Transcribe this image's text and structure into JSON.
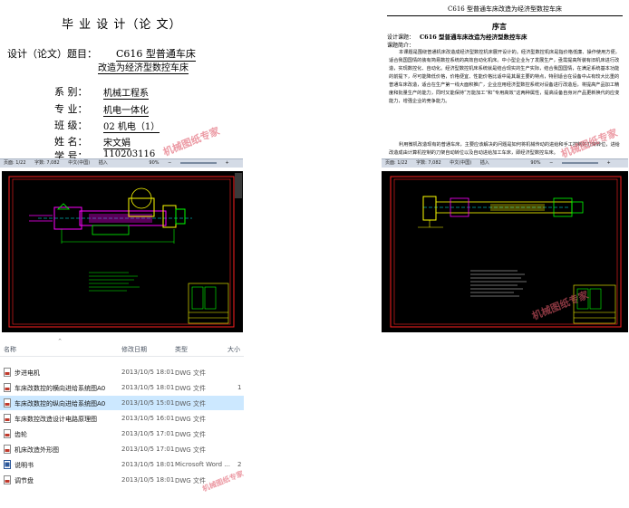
{
  "thesis_cover": {
    "title": "毕 业 设 计（论 文）",
    "topic_label": "设计（论文）题目：",
    "topic_line1": "C616 型普通车床",
    "topic_line2": "改造为经济型数控车床",
    "rows": [
      {
        "label": "系  别：",
        "value": "机械工程系"
      },
      {
        "label": "专  业：",
        "value": "机电一体化"
      },
      {
        "label": "班  级：",
        "value": "02 机电（1）"
      },
      {
        "label": "姓  名：",
        "value": "宋文娟"
      },
      {
        "label": "学  号：",
        "value": "110203116"
      }
    ]
  },
  "status_bar": {
    "page": "页面: 1/22",
    "words": "字数: 7,082",
    "lang": "中文(中国)",
    "mode": "插入",
    "zoom": "90%",
    "zoom_minus": "−",
    "zoom_plus": "+"
  },
  "preface_doc": {
    "header": "C616 型普通车床改造为经济型数控车床",
    "heading": "序言",
    "topic_label": "设计课题：",
    "topic": "C616 型普通车床改造为经济型数控车床",
    "intro_label": "课题简介：",
    "para1": "本课题是围绕普通机床改造成经济型数控机床展开设计的。经济型数控机床是指价格低廉、操作使用方便，适合我国国情的装有简易数控系统的高效自动化机床。中小型企业为了发展生产，亟需提高所装有旧机床进行改造，实现数控化、自动化。经济型数控机床系统就是结合现实的生产实际，结合我国国情，在满足系统基本功能的前提下，尽可能降低价格，价格便宜、性能价格比适中是其最主要的特点，特别适合在设备中占有较大比重的普通车床改造，适合在生产第一线大面积推广，企业应用经济型数控系统对设备进行改造后，将提高产品加工精度和批量生产的能力，同时又能保持“万能加工”和“专用高效”这两种属性，提高设备自身对产品更新换代的应变能力，增强企业的竞争能力。",
    "para2": "利用微机改造现有的普通车床，主要应该解决的问题是如何将机械传动的进给和手工控制的刀架转位，进给改造成由计算机控制的刀架自动转位以及自动进给加工车床，即经济型数控车床。"
  },
  "watermark_text": "机械图纸专家",
  "explorer": {
    "columns": {
      "name": "名称",
      "date": "修改日期",
      "type": "类型",
      "size": "大小"
    },
    "sort_indicator": "^",
    "files": [
      {
        "name": "步进电机",
        "date": "2013/10/5 18:01",
        "type": "DWG 文件",
        "size": "",
        "icon": "dwg-file-icon"
      },
      {
        "name": "车床改数控的横向进给系统图A0",
        "date": "2013/10/5 18:01",
        "type": "DWG 文件",
        "size": "1",
        "icon": "dwg-file-icon"
      },
      {
        "name": "车床改数控的纵向进给系统图A0",
        "date": "2013/10/5 15:01",
        "type": "DWG 文件",
        "size": "",
        "icon": "dwg-file-icon"
      },
      {
        "name": "车床数控改造设计电路原理图",
        "date": "2013/10/5 16:01",
        "type": "DWG 文件",
        "size": "",
        "icon": "dwg-file-icon"
      },
      {
        "name": "齿轮",
        "date": "2013/10/5 17:01",
        "type": "DWG 文件",
        "size": "",
        "icon": "dwg-file-icon"
      },
      {
        "name": "机床改造外形图",
        "date": "2013/10/5 17:01",
        "type": "DWG 文件",
        "size": "",
        "icon": "dwg-file-icon"
      },
      {
        "name": "说明书",
        "date": "2013/10/5 18:01",
        "type": "Microsoft Word ...",
        "size": "2",
        "icon": "word-file-icon"
      },
      {
        "name": "调节盘",
        "date": "2013/10/5 18:01",
        "type": "DWG 文件",
        "size": "",
        "icon": "dwg-file-icon"
      }
    ],
    "selected_index": 2
  },
  "colors": {
    "cad_bg": "#000000",
    "cad_frame": "#ff2020",
    "cad_magenta": "#ff00ff",
    "cad_yellow": "#ffff00",
    "cad_green": "#00ff00",
    "cad_cyan": "#00ffff",
    "selection": "#cce8ff",
    "watermark": "#e05a6a"
  }
}
